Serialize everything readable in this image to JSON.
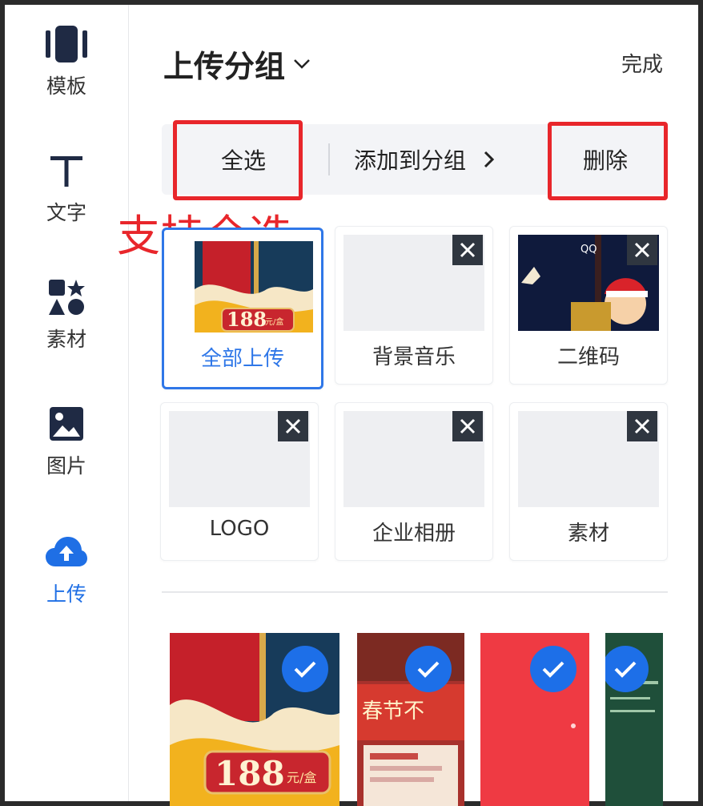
{
  "sidebar": {
    "items": [
      {
        "label": "模板",
        "icon": "template-icon"
      },
      {
        "label": "文字",
        "icon": "text-icon"
      },
      {
        "label": "素材",
        "icon": "shapes-icon"
      },
      {
        "label": "图片",
        "icon": "image-icon"
      },
      {
        "label": "上传",
        "icon": "upload-cloud-icon",
        "active": true
      }
    ]
  },
  "header": {
    "title": "上传分组",
    "done": "完成"
  },
  "actions": {
    "select_all": "全选",
    "add_to_group": "添加到分组",
    "delete": "删除"
  },
  "annotation": "支持全选",
  "groups": [
    {
      "label": "全部上传",
      "selected": true
    },
    {
      "label": "背景音乐"
    },
    {
      "label": "二维码"
    },
    {
      "label": "LOGO"
    },
    {
      "label": "企业相册"
    },
    {
      "label": "素材"
    }
  ],
  "thumb_text": {
    "price": "188",
    "unit": "元/盒",
    "spring": "春节不",
    "brand": "QQ"
  },
  "colors": {
    "accent": "#1f6fe5",
    "annotation_red": "#e8262b",
    "close_bg": "#2f3640",
    "bar_bg": "#f3f4f7"
  }
}
